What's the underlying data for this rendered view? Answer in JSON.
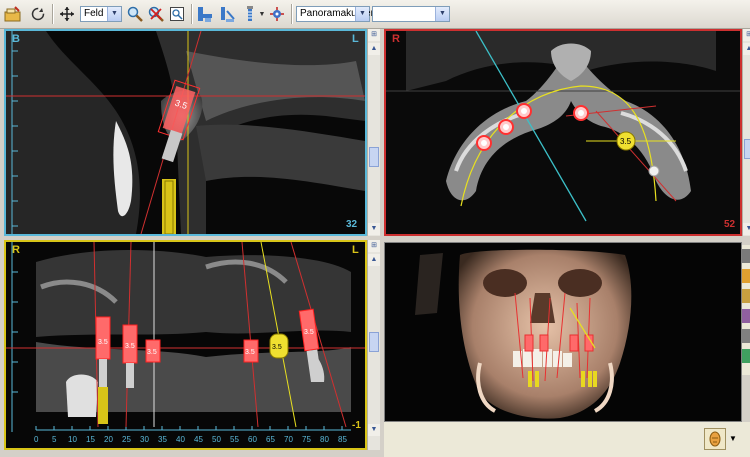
{
  "toolbar": {
    "mode_select": "Feld",
    "view_select": "Panoramakurven",
    "empty_select": ""
  },
  "panels": {
    "sagittal": {
      "orientation_left": "B",
      "orientation_right": "L",
      "slice": "32"
    },
    "axial": {
      "orientation_left": "R",
      "orientation_right": "L",
      "slice": "52"
    },
    "panoramic": {
      "orientation_left": "R",
      "orientation_right": "L",
      "slice": "-1",
      "ruler_ticks": [
        "0",
        "5",
        "10",
        "15",
        "20",
        "25",
        "30",
        "35",
        "40",
        "45",
        "50",
        "55",
        "60",
        "65",
        "70",
        "75",
        "80",
        "85"
      ],
      "implant_labels": [
        "3.5",
        "3.5",
        "3.5",
        "3.5",
        "3.5",
        "3.5"
      ]
    },
    "view3d": {}
  },
  "colors": {
    "sagittal_border": "#5ab8d8",
    "axial_border": "#cc3030",
    "panoramic_border": "#d8c418",
    "implant": "#e83030",
    "planning_line": "#e8e020"
  }
}
